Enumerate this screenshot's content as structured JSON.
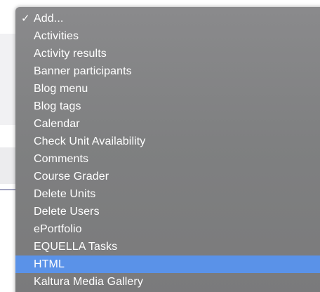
{
  "menu": {
    "items": [
      {
        "label": "Add...",
        "checked": true
      },
      {
        "label": "Activities"
      },
      {
        "label": "Activity results"
      },
      {
        "label": "Banner participants"
      },
      {
        "label": "Blog menu"
      },
      {
        "label": "Blog tags"
      },
      {
        "label": "Calendar"
      },
      {
        "label": "Check Unit Availability"
      },
      {
        "label": "Comments"
      },
      {
        "label": "Course Grader"
      },
      {
        "label": "Delete Units"
      },
      {
        "label": "Delete Users"
      },
      {
        "label": "ePortfolio"
      },
      {
        "label": "EQUELLA Tasks"
      },
      {
        "label": "HTML",
        "highlighted": true
      },
      {
        "label": "Kaltura Media Gallery"
      }
    ],
    "check_glyph": "✓",
    "highlight_color": "#5a92e8",
    "background_color": "#808082"
  }
}
